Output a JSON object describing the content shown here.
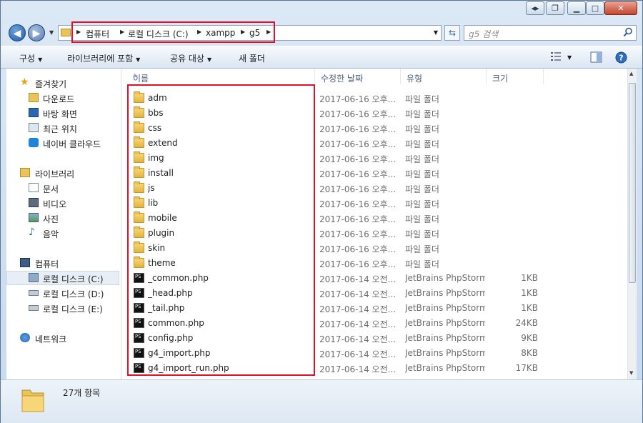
{
  "address": {
    "crumbs": [
      "컴퓨터",
      "로컬 디스크 (C:)",
      "xampp",
      "g5"
    ]
  },
  "search": {
    "placeholder": "g5 검색"
  },
  "toolbar": {
    "organize": "구성",
    "include_library": "라이브러리에 포함",
    "share_with": "공유 대상",
    "new_folder": "새 폴더"
  },
  "nav": {
    "favorites": {
      "label": "즐겨찾기",
      "items": [
        "다운로드",
        "바탕 화면",
        "최근 위치",
        "네이버 클라우드"
      ]
    },
    "libraries": {
      "label": "라이브러리",
      "items": [
        "문서",
        "비디오",
        "사진",
        "음악"
      ]
    },
    "computer": {
      "label": "컴퓨터",
      "items": [
        "로컬 디스크 (C:)",
        "로컬 디스크 (D:)",
        "로컬 디스크 (E:)"
      ]
    },
    "network": {
      "label": "네트워크"
    }
  },
  "columns": {
    "name": "이름",
    "date": "수정한 날짜",
    "type": "유형",
    "size": "크기"
  },
  "files": [
    {
      "name": "adm",
      "date": "2017-06-16 오후...",
      "type": "파일 폴더",
      "size": "",
      "icon": "folder-icon"
    },
    {
      "name": "bbs",
      "date": "2017-06-16 오후...",
      "type": "파일 폴더",
      "size": "",
      "icon": "folder-icon"
    },
    {
      "name": "css",
      "date": "2017-06-16 오후...",
      "type": "파일 폴더",
      "size": "",
      "icon": "folder-icon"
    },
    {
      "name": "extend",
      "date": "2017-06-16 오후...",
      "type": "파일 폴더",
      "size": "",
      "icon": "folder-icon"
    },
    {
      "name": "img",
      "date": "2017-06-16 오후...",
      "type": "파일 폴더",
      "size": "",
      "icon": "folder-icon"
    },
    {
      "name": "install",
      "date": "2017-06-16 오후...",
      "type": "파일 폴더",
      "size": "",
      "icon": "folder-icon"
    },
    {
      "name": "js",
      "date": "2017-06-16 오후...",
      "type": "파일 폴더",
      "size": "",
      "icon": "folder-icon"
    },
    {
      "name": "lib",
      "date": "2017-06-16 오후...",
      "type": "파일 폴더",
      "size": "",
      "icon": "folder-icon"
    },
    {
      "name": "mobile",
      "date": "2017-06-16 오후...",
      "type": "파일 폴더",
      "size": "",
      "icon": "folder-icon"
    },
    {
      "name": "plugin",
      "date": "2017-06-16 오후...",
      "type": "파일 폴더",
      "size": "",
      "icon": "folder-icon"
    },
    {
      "name": "skin",
      "date": "2017-06-16 오후...",
      "type": "파일 폴더",
      "size": "",
      "icon": "folder-icon"
    },
    {
      "name": "theme",
      "date": "2017-06-16 오후...",
      "type": "파일 폴더",
      "size": "",
      "icon": "folder-icon"
    },
    {
      "name": "_common.php",
      "date": "2017-06-14 오전...",
      "type": "JetBrains PhpStorm",
      "size": "1KB",
      "icon": "phpstorm-icon"
    },
    {
      "name": "_head.php",
      "date": "2017-06-14 오전...",
      "type": "JetBrains PhpStorm",
      "size": "1KB",
      "icon": "phpstorm-icon"
    },
    {
      "name": "_tail.php",
      "date": "2017-06-14 오전...",
      "type": "JetBrains PhpStorm",
      "size": "1KB",
      "icon": "phpstorm-icon"
    },
    {
      "name": "common.php",
      "date": "2017-06-14 오전...",
      "type": "JetBrains PhpStorm",
      "size": "24KB",
      "icon": "phpstorm-icon"
    },
    {
      "name": "config.php",
      "date": "2017-06-14 오전...",
      "type": "JetBrains PhpStorm",
      "size": "9KB",
      "icon": "phpstorm-icon"
    },
    {
      "name": "g4_import.php",
      "date": "2017-06-14 오전...",
      "type": "JetBrains PhpStorm",
      "size": "8KB",
      "icon": "phpstorm-icon"
    },
    {
      "name": "g4_import_run.php",
      "date": "2017-06-14 오전...",
      "type": "JetBrains PhpStorm",
      "size": "17KB",
      "icon": "phpstorm-icon"
    }
  ],
  "status": {
    "item_count": "27개 항목"
  },
  "colors": {
    "highlight_box": "#e0102a",
    "selected_nav": "#e8eef5"
  }
}
